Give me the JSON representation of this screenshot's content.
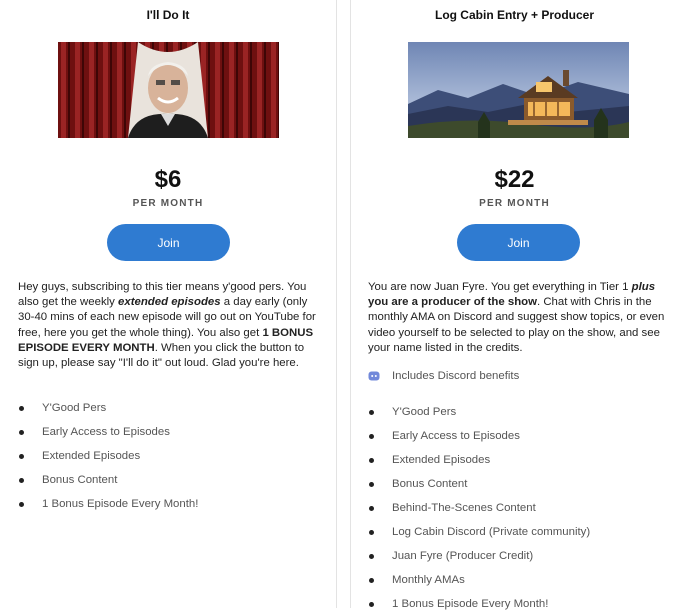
{
  "tiers": [
    {
      "title": "I'll Do It",
      "price": "$6",
      "period": "PER MONTH",
      "join_label": "Join",
      "desc": [
        {
          "t": "Hey guys, subscribing to this tier means y'good pers. You also get the weekly ",
          "s": ""
        },
        {
          "t": "extended episodes",
          "s": "bi"
        },
        {
          "t": " a day early (only 30-40 mins of each new episode will go out on YouTube for free, here you get the whole thing). You also get ",
          "s": ""
        },
        {
          "t": "1 BONUS EPISODE EVERY MONTH",
          "s": "b"
        },
        {
          "t": ". When you click the button to sign up, please say \"I'll do it\" out loud. Glad you're here.",
          "s": ""
        }
      ],
      "benefits": [
        "Y'Good Pers",
        "Early Access to Episodes",
        "Extended Episodes",
        "Bonus Content",
        "1 Bonus Episode Every Month!"
      ]
    },
    {
      "title": "Log Cabin Entry + Producer",
      "price": "$22",
      "period": "PER MONTH",
      "join_label": "Join",
      "desc": [
        {
          "t": "You are now Juan Fyre. You get everything in Tier 1 ",
          "s": ""
        },
        {
          "t": "plus",
          "s": "bi"
        },
        {
          "t": " you are a producer of the show",
          "s": "b"
        },
        {
          "t": ". Chat with Chris in the monthly AMA on Discord and suggest show topics, or even video yourself to be selected to play on the show, and see your name listed in the credits.",
          "s": ""
        }
      ],
      "discord_label": "Includes Discord benefits",
      "benefits": [
        "Y'Good Pers",
        "Early Access to Episodes",
        "Extended Episodes",
        "Bonus Content",
        "Behind-The-Scenes Content",
        "Log Cabin Discord (Private community)",
        "Juan Fyre (Producer Credit)",
        "Monthly AMAs",
        "1 Bonus Episode Every Month!"
      ]
    }
  ],
  "colors": {
    "accent": "#2f7bd1",
    "discord": "#7289da",
    "curtain": "#7a1414"
  },
  "icons": {
    "discord": "discord-icon",
    "bullet": "bullet-dot"
  }
}
